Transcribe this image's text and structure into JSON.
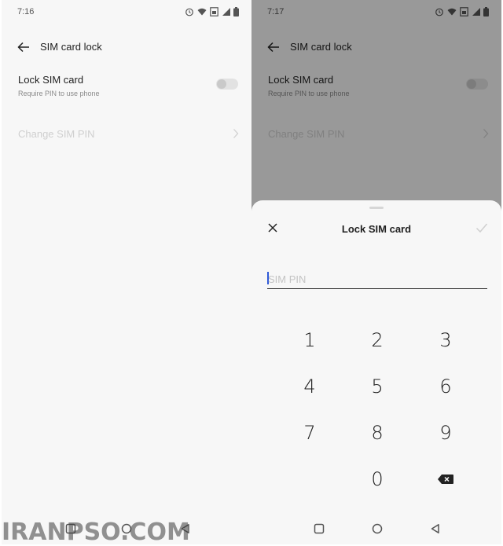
{
  "left_screen": {
    "status": {
      "time": "7:16"
    },
    "header": {
      "title": "SIM card lock"
    },
    "lock_row": {
      "label": "Lock SIM card",
      "sublabel": "Require PIN to use phone",
      "enabled": false
    },
    "change_row": {
      "label": "Change SIM PIN"
    }
  },
  "right_screen": {
    "status": {
      "time": "7:17"
    },
    "header": {
      "title": "SIM card lock"
    },
    "lock_row": {
      "label": "Lock SIM card",
      "sublabel": "Require PIN to use phone",
      "enabled": false
    },
    "change_row": {
      "label": "Change SIM PIN"
    },
    "dialog": {
      "title": "Lock SIM card",
      "input": {
        "placeholder": "SIM PIN",
        "value": ""
      },
      "keys": [
        "1",
        "2",
        "3",
        "4",
        "5",
        "6",
        "7",
        "8",
        "9",
        "0"
      ]
    }
  },
  "icons": {
    "status": [
      "alarm-icon",
      "wifi-icon",
      "sim-icon",
      "signal-icon",
      "battery-icon"
    ],
    "header": "back-arrow-icon",
    "row": "chevron-right-icon",
    "dialog": [
      "close-icon",
      "check-icon",
      "backspace-icon"
    ],
    "nav": [
      "recents-square-icon",
      "home-circle-icon",
      "back-triangle-icon"
    ]
  },
  "colors": {
    "cursor": "#2f5ad8",
    "dim_overlay": "rgba(0,0,0,0.38)"
  },
  "watermark": "IRANPSO.COM"
}
